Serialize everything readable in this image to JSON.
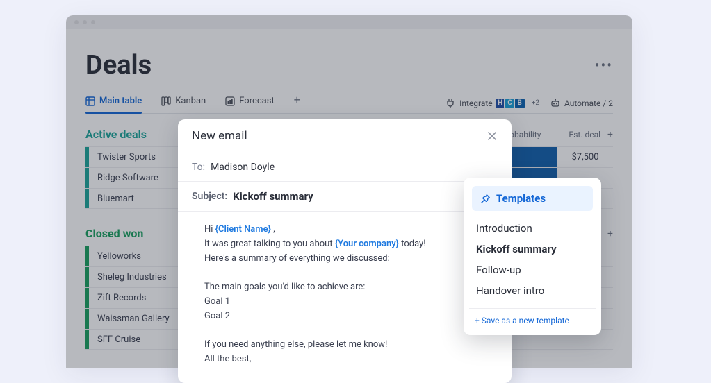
{
  "page": {
    "title": "Deals"
  },
  "view_tabs": {
    "main_table": "Main table",
    "kanban": "Kanban",
    "forecast": "Forecast"
  },
  "toolbar": {
    "integrate": "Integrate",
    "automate": "Automate / 2",
    "avatars_more": "+2"
  },
  "columns": {
    "probability": "Probability",
    "est_deal": "Est. deal"
  },
  "groups": {
    "active": {
      "title": "Active deals",
      "rows": [
        "Twister Sports",
        "Ridge Software",
        "Bluemart"
      ],
      "deals": [
        "$7,500"
      ]
    },
    "closed": {
      "title": "Closed won",
      "rows": [
        "Yelloworks",
        "Sheleg Industries",
        "Zift Records",
        "Waissman Gallery",
        "SFF Cruise"
      ]
    }
  },
  "email": {
    "title": "New email",
    "to_label": "To:",
    "to_value": "Madison Doyle",
    "subject_label": "Subject:",
    "subject_value": "Kickoff summary",
    "body": {
      "hi_prefix": "Hi ",
      "client_token": "{Client Name}",
      "hi_suffix": " ,",
      "line2_pre": "It was great talking to you about ",
      "your_company_token": "{Your company}",
      "line2_post": " today!",
      "line3": "Here's a summary of everything we discussed:",
      "line5": "The main goals you'd like to achieve are:",
      "goal1": "Goal 1",
      "goal2": "Goal 2",
      "line8": "If you need anything else, please let me know!",
      "line9": "All the best,"
    }
  },
  "templates": {
    "header": "Templates",
    "items": [
      "Introduction",
      "Kickoff summary",
      "Follow-up",
      "Handover intro"
    ],
    "selected_index": 1,
    "save": "+ Save as a new template"
  }
}
